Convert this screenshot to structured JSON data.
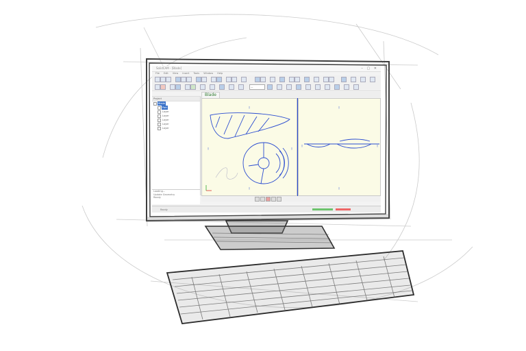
{
  "app": {
    "title": "SolidCAM - [Blade]",
    "window_controls": "– ▢ ✕",
    "menu": [
      "File",
      "Edit",
      "View",
      "Insert",
      "Tools",
      "Window",
      "Help"
    ],
    "combo_value": "—",
    "active_tab": "Blade",
    "tree": {
      "header": "Project",
      "items": [
        {
          "label": "Blade",
          "selected": true
        },
        {
          "label": "Part",
          "selected": true
        },
        {
          "label": "Layer",
          "selected": false
        },
        {
          "label": "Layer",
          "selected": false
        },
        {
          "label": "Layer",
          "selected": false
        },
        {
          "label": "Layer",
          "selected": false
        },
        {
          "label": "Layer",
          "selected": false
        }
      ]
    },
    "log_lines": [
      "Loading...",
      "Update Geometry",
      "Ready"
    ],
    "status_text": "Ready"
  },
  "icons": [
    "tree-expand-icon",
    "axis-triad-icon",
    "view-toolbar-icon"
  ],
  "colors": {
    "viewport_bg": "#fbfbe6",
    "geometry_blue": "#2a4cd0",
    "tab_text": "#2f7a2f",
    "selection": "#3b73c9"
  }
}
